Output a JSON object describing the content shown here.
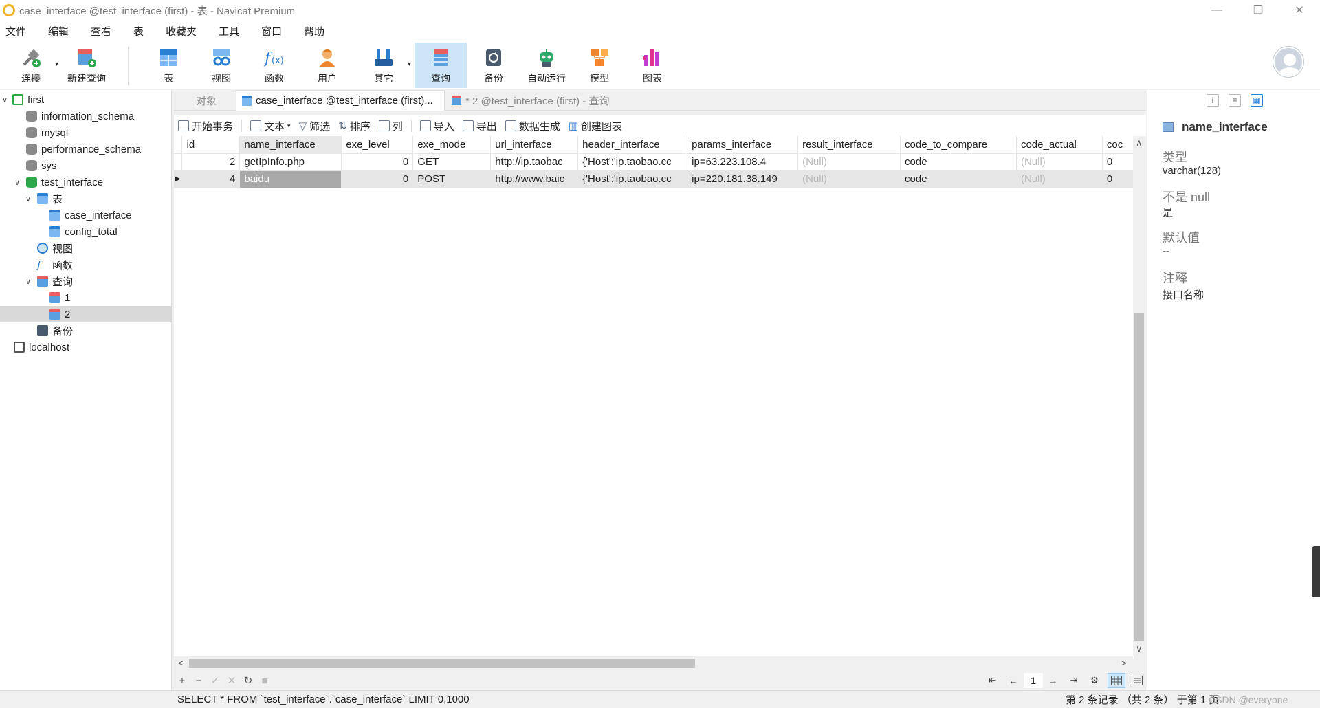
{
  "window": {
    "title": "case_interface @test_interface (first) - 表 - Navicat Premium",
    "minimize": "—",
    "restore": "❐",
    "close": "✕"
  },
  "menu": [
    "文件",
    "编辑",
    "查看",
    "表",
    "收藏夹",
    "工具",
    "窗口",
    "帮助"
  ],
  "toolbar": [
    {
      "label": "连接",
      "icon": "connect-icon"
    },
    {
      "label": "新建查询",
      "icon": "new-query-icon"
    },
    {
      "label": "表",
      "icon": "table-icon"
    },
    {
      "label": "视图",
      "icon": "view-icon"
    },
    {
      "label": "函数",
      "icon": "function-icon"
    },
    {
      "label": "用户",
      "icon": "user-icon"
    },
    {
      "label": "其它",
      "icon": "other-icon"
    },
    {
      "label": "查询",
      "icon": "query-icon"
    },
    {
      "label": "备份",
      "icon": "backup-icon"
    },
    {
      "label": "自动运行",
      "icon": "automation-icon"
    },
    {
      "label": "模型",
      "icon": "model-icon"
    },
    {
      "label": "图表",
      "icon": "chart-icon"
    }
  ],
  "tree": [
    {
      "label": "first",
      "level": 0,
      "toggle": "expanded"
    },
    {
      "label": "information_schema",
      "level": 1,
      "toggle": "none"
    },
    {
      "label": "mysql",
      "level": 1,
      "toggle": "none"
    },
    {
      "label": "performance_schema",
      "level": 1,
      "toggle": "none"
    },
    {
      "label": "sys",
      "level": 1,
      "toggle": "none"
    },
    {
      "label": "test_interface",
      "level": 1,
      "toggle": "expanded"
    },
    {
      "label": "表",
      "level": 2,
      "toggle": "expanded"
    },
    {
      "label": "case_interface",
      "level": 3,
      "toggle": "none"
    },
    {
      "label": "config_total",
      "level": 3,
      "toggle": "none"
    },
    {
      "label": "视图",
      "level": 2,
      "toggle": "none"
    },
    {
      "label": "函数",
      "level": 2,
      "toggle": "none"
    },
    {
      "label": "查询",
      "level": 2,
      "toggle": "expanded"
    },
    {
      "label": "1",
      "level": 3,
      "toggle": "none"
    },
    {
      "label": "2",
      "level": 3,
      "toggle": "none",
      "selected": true
    },
    {
      "label": "备份",
      "level": 2,
      "toggle": "none"
    },
    {
      "label": "localhost",
      "level": 0,
      "toggle": "none"
    }
  ],
  "tabs": {
    "objects": "对象",
    "active": "case_interface @test_interface (first)...",
    "inactive": "* 2 @test_interface (first) - 查询"
  },
  "subtoolbar": {
    "begin_tx": "开始事务",
    "text": "文本",
    "filter": "筛选",
    "sort": "排序",
    "columns": "列",
    "import": "导入",
    "export": "导出",
    "datagen": "数据生成",
    "create_chart": "创建图表"
  },
  "grid": {
    "columns": [
      "id",
      "name_interface",
      "exe_level",
      "exe_mode",
      "url_interface",
      "header_interface",
      "params_interface",
      "result_interface",
      "code_to_compare",
      "code_actual",
      "coc"
    ],
    "rows": [
      [
        "2",
        "getIpInfo.php",
        "0",
        "GET",
        "http://ip.taobac",
        "{'Host':'ip.taobao.cc",
        "ip=63.223.108.4",
        "(Null)",
        "code",
        "(Null)",
        "0"
      ],
      [
        "4",
        "baidu",
        "0",
        "POST",
        "http://www.baic",
        "{'Host':'ip.taobao.cc",
        "ip=220.181.38.149",
        "(Null)",
        "code",
        "(Null)",
        "0"
      ]
    ]
  },
  "bottombar": {
    "add": "+",
    "remove": "−",
    "apply": "✓",
    "discard": "✕",
    "refresh": "↻",
    "stop": "■",
    "page": "1"
  },
  "status": {
    "sql": "SELECT * FROM `test_interface`.`case_interface` LIMIT 0,1000",
    "records": "第 2 条记录 （共 2 条） 于第 1 页",
    "watermark": "CSDN @everyone"
  },
  "right_panel": {
    "field_name": "name_interface",
    "type_label": "类型",
    "type_value": "varchar(128)",
    "notnull_label": "不是 null",
    "notnull_value": "是",
    "default_label": "默认值",
    "default_value": "--",
    "comment_label": "注释",
    "comment_value": "接口名称"
  }
}
